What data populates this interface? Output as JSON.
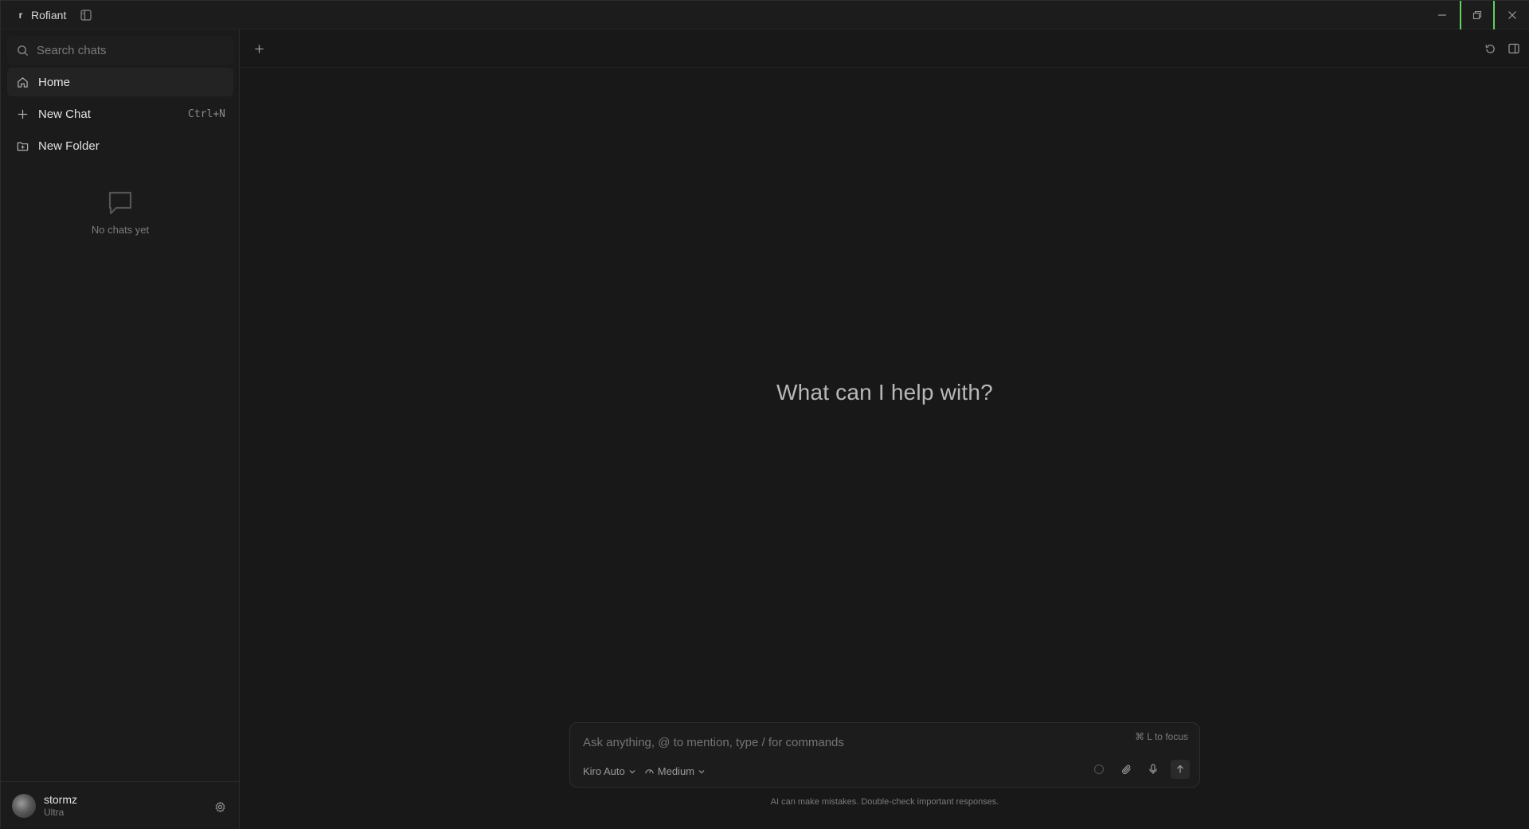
{
  "app": {
    "title": "Rofiant",
    "logo_glyph": "r"
  },
  "window_controls": {
    "minimize_icon": "minimize-icon",
    "maximize_icon": "restore-icon",
    "close_icon": "close-icon",
    "maximize_accent": "#5fd15f"
  },
  "sidebar": {
    "search": {
      "placeholder": "Search chats"
    },
    "items": [
      {
        "label": "Home",
        "icon": "home-icon",
        "active": true,
        "shortcut": ""
      },
      {
        "label": "New Chat",
        "icon": "plus-icon",
        "active": false,
        "shortcut": "Ctrl+N"
      },
      {
        "label": "New Folder",
        "icon": "folder-plus-icon",
        "active": false,
        "shortcut": ""
      }
    ],
    "empty_state": {
      "icon": "message-square-icon",
      "text": "No chats yet"
    },
    "user": {
      "name": "stormz",
      "plan": "Ultra"
    }
  },
  "main": {
    "hero_text": "What can I help with?",
    "composer": {
      "placeholder": "Ask anything, @ to mention, type / for commands",
      "focus_hint": "⌘ L to focus",
      "model": "Kiro Auto",
      "effort": "Medium"
    },
    "disclaimer": "AI can make mistakes. Double-check important responses."
  },
  "colors": {
    "background": "#181818",
    "sidebar": "#1b1b1b",
    "text": "#d4d4d4",
    "muted": "#7a7a7a"
  }
}
